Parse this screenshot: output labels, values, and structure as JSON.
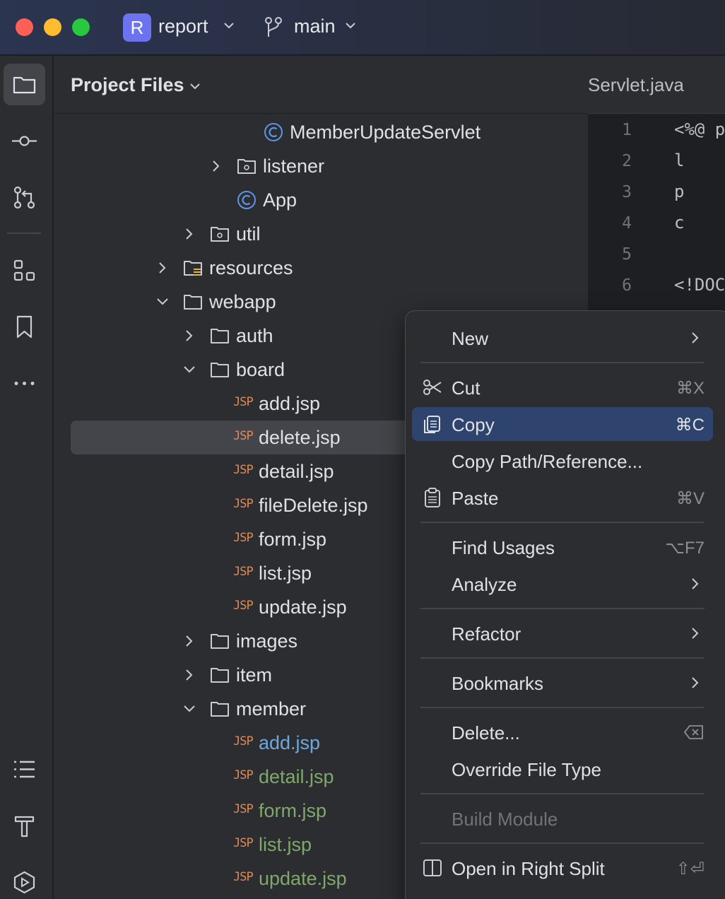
{
  "titlebar": {
    "project_badge": "R",
    "project_name": "report",
    "branch_name": "main"
  },
  "project_panel": {
    "title": "Project Files",
    "tree": [
      {
        "label": "MemberUpdateServlet",
        "type": "class"
      },
      {
        "label": "listener",
        "type": "package",
        "expanded": false
      },
      {
        "label": "App",
        "type": "class"
      },
      {
        "label": "util",
        "type": "package",
        "expanded": false
      },
      {
        "label": "resources",
        "type": "resources-folder",
        "expanded": false
      },
      {
        "label": "webapp",
        "type": "folder",
        "expanded": true
      },
      {
        "label": "auth",
        "type": "folder",
        "expanded": false
      },
      {
        "label": "board",
        "type": "folder",
        "expanded": true
      },
      {
        "label": "add.jsp",
        "type": "jsp"
      },
      {
        "label": "delete.jsp",
        "type": "jsp",
        "selected": true
      },
      {
        "label": "detail.jsp",
        "type": "jsp"
      },
      {
        "label": "fileDelete.jsp",
        "type": "jsp"
      },
      {
        "label": "form.jsp",
        "type": "jsp"
      },
      {
        "label": "list.jsp",
        "type": "jsp"
      },
      {
        "label": "update.jsp",
        "type": "jsp"
      },
      {
        "label": "images",
        "type": "folder",
        "expanded": false
      },
      {
        "label": "item",
        "type": "folder",
        "expanded": false
      },
      {
        "label": "member",
        "type": "folder",
        "expanded": true
      },
      {
        "label": "add.jsp",
        "type": "jsp",
        "status": "modified"
      },
      {
        "label": "detail.jsp",
        "type": "jsp",
        "status": "added"
      },
      {
        "label": "form.jsp",
        "type": "jsp",
        "status": "added"
      },
      {
        "label": "list.jsp",
        "type": "jsp",
        "status": "added"
      },
      {
        "label": "update.jsp",
        "type": "jsp",
        "status": "added"
      }
    ],
    "jsp_badge": "JSP"
  },
  "editor": {
    "tab_label": "Servlet.java",
    "line_numbers": [
      "1",
      "2",
      "3",
      "4",
      "5",
      "6"
    ],
    "code_lines": [
      "<%@ p",
      "    l",
      "    p",
      "    c",
      "",
      "<!DOC"
    ]
  },
  "context_menu": {
    "items": [
      {
        "label": "New",
        "submenu": true
      },
      {
        "label": "Cut",
        "shortcut": "⌘X",
        "icon": "scissors-icon"
      },
      {
        "label": "Copy",
        "shortcut": "⌘C",
        "icon": "copy-icon",
        "active": true
      },
      {
        "label": "Copy Path/Reference..."
      },
      {
        "label": "Paste",
        "shortcut": "⌘V",
        "icon": "paste-icon"
      },
      {
        "label": "Find Usages",
        "shortcut": "⌥F7"
      },
      {
        "label": "Analyze",
        "submenu": true
      },
      {
        "label": "Refactor",
        "submenu": true
      },
      {
        "label": "Bookmarks",
        "submenu": true
      },
      {
        "label": "Delete...",
        "icon_shortcut": "delete-key-icon"
      },
      {
        "label": "Override File Type"
      },
      {
        "label": "Build Module",
        "disabled": true
      },
      {
        "label": "Open in Right Split",
        "shortcut": "⇧⏎",
        "icon": "split-icon"
      }
    ]
  },
  "colors": {
    "accent": "#2e436e",
    "jsp_badge": "#e08855",
    "vcs_modified": "#6fa8dc",
    "vcs_added": "#7fa86a"
  }
}
